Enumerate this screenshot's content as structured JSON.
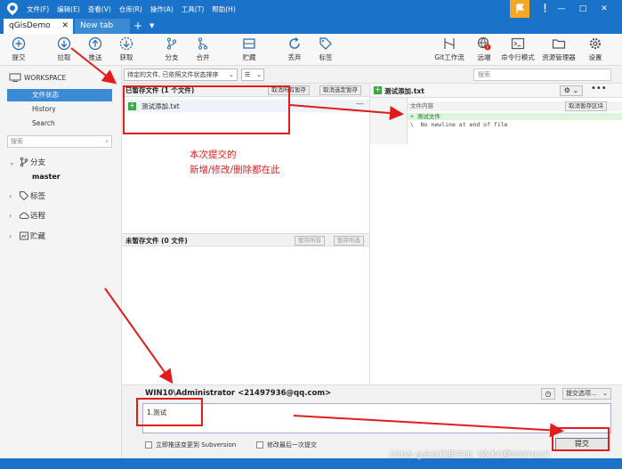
{
  "menu": [
    "文件(F)",
    "编辑(E)",
    "查看(V)",
    "仓库(R)",
    "操作(A)",
    "工具(T)",
    "帮助(H)"
  ],
  "window_controls": {
    "minimize": "—",
    "maximize": "□",
    "close": "✕"
  },
  "tabs": [
    {
      "label": "qGisDemo",
      "close": "✕"
    },
    {
      "label": "New tab"
    }
  ],
  "toolbar": {
    "commit": "提交",
    "pull": "拉取",
    "push": "推送",
    "fetch": "获取",
    "branch": "分支",
    "merge": "合并",
    "stash": "贮藏",
    "discard": "丢弃",
    "tag": "标签",
    "git_flow": "Git工作流",
    "remote": "远端",
    "terminal": "命令行模式",
    "explorer": "资源管理器",
    "settings": "设置"
  },
  "sidebar": {
    "workspace": "WORKSPACE",
    "items": [
      {
        "label": "文件状态"
      },
      {
        "label": "History"
      },
      {
        "label": "Search"
      }
    ],
    "search_placeholder": "搜索",
    "sections": [
      {
        "label": "分支"
      },
      {
        "label": "标签"
      },
      {
        "label": "远程"
      },
      {
        "label": "贮藏"
      }
    ],
    "current_branch": "master"
  },
  "filter": {
    "sort": "待定的文件, 已依照文件状态排序",
    "view": "☰",
    "search_placeholder": "搜索"
  },
  "staged": {
    "title": "已暂存文件 (1 个文件)",
    "unstage_all": "取消所有暂存",
    "unstage_selected": "取消选定暂存",
    "files": [
      {
        "name": "测试添加.txt",
        "status": "+"
      }
    ]
  },
  "unstaged": {
    "title": "未暂存文件 (0 文件)",
    "stage_all": "暂存所有",
    "stage_selected": "暂存所选"
  },
  "diff": {
    "file": "测试添加.txt",
    "hunk": "文件内容",
    "hunk_button": "取消暂存区块",
    "lines": [
      {
        "type": "add",
        "text": "+ 测试文件"
      },
      {
        "type": "ctx",
        "text": "\\  No newline at end of file"
      }
    ]
  },
  "commit": {
    "author": "WIN10\\Administrator <21497936@qq.com>",
    "options": "提交选项...",
    "message": "1.测试",
    "push_svn": "立即推送变更到 Subversion",
    "amend": "修改最后一次提交",
    "button": "提交"
  },
  "annotation": {
    "line1": "本次提交的",
    "line2": "新增/修改/删除都在此"
  },
  "watermark": "CSDN @长沙红胖子Qt（技术Q群4597637）",
  "colors": {
    "accent": "#1b73c9",
    "annotation": "#e21b1b",
    "added": "#3aa845"
  }
}
